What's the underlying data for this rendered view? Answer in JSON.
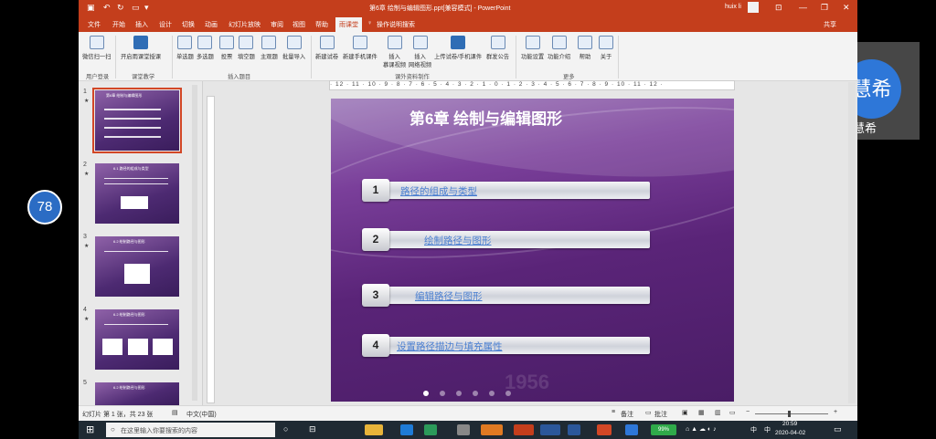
{
  "window": {
    "title": "第6章 绘制与编辑图形.ppt[兼容模式] - PowerPoint",
    "user": "huix li",
    "share": "共享"
  },
  "tabs": [
    "文件",
    "开始",
    "插入",
    "设计",
    "切换",
    "动画",
    "幻灯片放映",
    "审阅",
    "视图",
    "帮助",
    "雨课堂"
  ],
  "active_tab": "雨课堂",
  "tell_me": "操作说明搜索",
  "ribbon": {
    "login": "微信扫一扫",
    "start_class": "开启雨课堂授课",
    "q_single": "单选题",
    "q_multi": "多选题",
    "q_vote": "投票",
    "q_fill": "填空题",
    "q_subjective": "主观题",
    "q_batch": "批量导入",
    "new_exam": "新建试卷",
    "new_mobile": "新建手机课件",
    "insert_mooc_1": "插入",
    "insert_mooc_2": "慕课视频",
    "insert_web_1": "插入",
    "insert_web_2": "网络视频",
    "upload": "上传试卷/手机课件",
    "publish": "群发公告",
    "settings": "功能设置",
    "intro": "功能介绍",
    "help": "帮助",
    "about": "关于",
    "groups": [
      "用户登录",
      "课堂教学",
      "插入题目",
      "课外资料制作",
      "更多"
    ]
  },
  "ruler_text": "· 12 · 11 · 10 · 9 · 8 · 7 · 6 · 5 · 4 · 3 · 2 · 1 · 0 · 1 · 2 · 3 · 4 · 5 · 6 · 7 · 8 · 9 · 10 · 11 · 12 ·",
  "thumbnails": [
    {
      "num": "1",
      "title": "第6章 绘制与编辑图形"
    },
    {
      "num": "2",
      "title": "6.1 路径的组成与类型"
    },
    {
      "num": "3",
      "title": "6.2 绘制路径与图形"
    },
    {
      "num": "4",
      "title": "6.2 绘制路径与图形"
    },
    {
      "num": "5",
      "title": "6.2 绘制路径与图形"
    }
  ],
  "slide": {
    "title": "第6章  绘制与编辑图形",
    "items": [
      {
        "num": "1",
        "label": "路径的组成与类型"
      },
      {
        "num": "2",
        "label": "绘制路径与图形"
      },
      {
        "num": "3",
        "label": "编辑路径与图形"
      },
      {
        "num": "4",
        "label": "设置路径描边与填充属性"
      }
    ],
    "watermark": "1956"
  },
  "status": {
    "slide_info": "幻灯片 第 1 张，共 23 张",
    "language": "中文(中国)",
    "notes": "备注",
    "comments": "批注"
  },
  "taskbar": {
    "search_placeholder": "在这里输入你要搜索的内容",
    "time": "20:59",
    "date": "2020-04-02",
    "battery": "99%",
    "ime": "中",
    "ime_lang": "中"
  },
  "overlays": {
    "badge": "78",
    "camera_avatar": "慧希",
    "camera_name": "李慧希"
  },
  "colors": {
    "accent": "#c43e1c",
    "slide_link": "#4a7fd1"
  }
}
